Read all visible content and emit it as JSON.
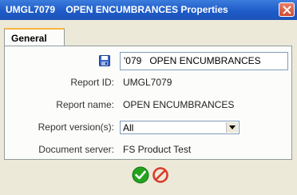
{
  "window": {
    "title": "UMGL7079    OPEN ENCUMBRANCES Properties"
  },
  "tabs": [
    {
      "label": "General"
    }
  ],
  "general": {
    "name_value": "'079   OPEN ENCUMBRANCES",
    "report_id_label": "Report ID:",
    "report_id_value": "UMGL7079",
    "report_name_label": "Report name:",
    "report_name_value": "OPEN ENCUMBRANCES",
    "report_version_label": "Report version(s):",
    "report_version_selected": "All",
    "document_server_label": "Document server:",
    "document_server_value": "FS Product Test"
  },
  "icons": {
    "save": "save-icon",
    "close": "close-icon",
    "ok": "check-icon",
    "cancel": "cancel-icon",
    "dropdown": "chevron-down-icon"
  },
  "colors": {
    "titlebar": "#1f5cc9",
    "close": "#d0482c",
    "ok": "#22a31e",
    "cancel": "#d93a2b",
    "tab_accent": "#f7b640"
  }
}
